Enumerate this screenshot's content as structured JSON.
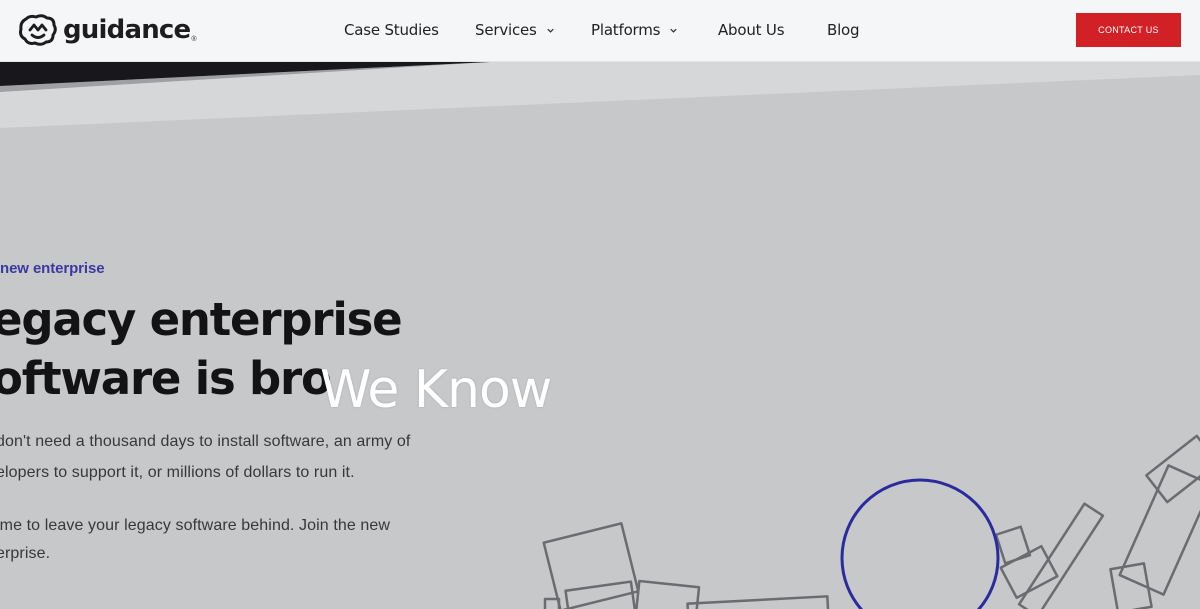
{
  "brand": {
    "name": "guidance",
    "reg": "®"
  },
  "nav": {
    "items": [
      {
        "label": "Case Studies",
        "has_dropdown": false
      },
      {
        "label": "Services",
        "has_dropdown": true
      },
      {
        "label": "Platforms",
        "has_dropdown": true
      },
      {
        "label": "About Us",
        "has_dropdown": false
      },
      {
        "label": "Blog",
        "has_dropdown": false
      }
    ],
    "contact_label": "CONTACT US"
  },
  "hero": {
    "eyebrow": "new enterprise",
    "headline_line1": "egacy enterprise",
    "headline_line2": "oftware is bro",
    "paragraph1_line1": "don't need a thousand days to install software, an army of",
    "paragraph1_line2": "elopers to support it, or millions of dollars to run it.",
    "paragraph2_line1": "ime to leave your legacy software behind. Join the new",
    "paragraph2_line2": "erprise.",
    "overlay": "We Know"
  },
  "colors": {
    "accent_red": "#d12127",
    "eyebrow_blue": "#3a3aa0",
    "circle_blue": "#2b2b9e",
    "hero_bg": "#c7c8ca",
    "nav_bg": "#f5f6f8"
  }
}
